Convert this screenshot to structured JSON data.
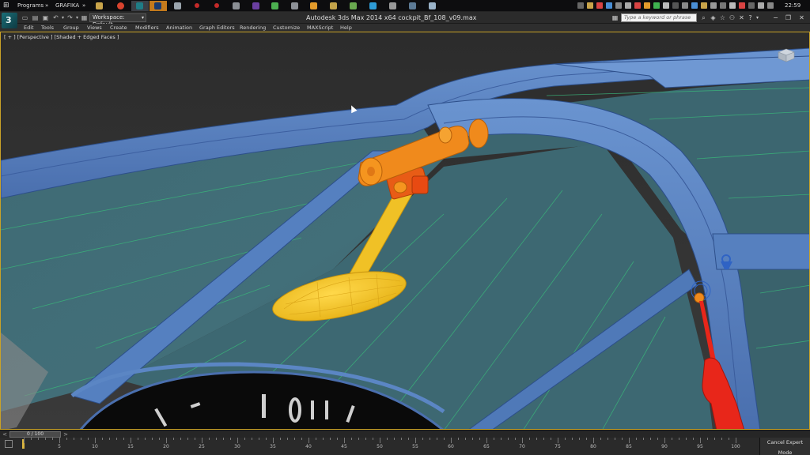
{
  "taskbar": {
    "start_label": "Programs",
    "folder_label": "GRAFIKA",
    "chevron_left": "»",
    "chevron_right": "»",
    "clock": "22:59"
  },
  "titlebar": {
    "workspace": "Workspace: Default",
    "title": "Autodesk 3ds Max  2014 x64      cockpit_Bf_108_v09.max",
    "search_placeholder": "Type a keyword or phrase"
  },
  "menu": {
    "items": [
      "Edit",
      "Tools",
      "Group",
      "Views",
      "Create",
      "Modifiers",
      "Animation",
      "Graph Editors",
      "Rendering",
      "Customize",
      "MAXScript",
      "Help"
    ]
  },
  "viewport": {
    "label": "[ + ] [Perspective ] [Shaded + Edged Faces ]"
  },
  "timeslider": {
    "position": "0 / 100",
    "prev": "<",
    "next": ">"
  },
  "trackbar": {
    "ticks": [
      "5",
      "10",
      "15",
      "20",
      "25",
      "30",
      "35",
      "40",
      "45",
      "50",
      "55",
      "60",
      "65",
      "70",
      "75",
      "80",
      "85",
      "90",
      "95",
      "100"
    ]
  },
  "status": {
    "cancel_expert": "Cancel Expert Mode"
  },
  "colors": {
    "frame_blue": "#5b86c4",
    "glass_teal": "#3f6c77",
    "mirror_yellow": "#f2c21f",
    "bracket_orange": "#f08a1c",
    "handle_red": "#e8261a",
    "selection_border": "#c9a227"
  }
}
